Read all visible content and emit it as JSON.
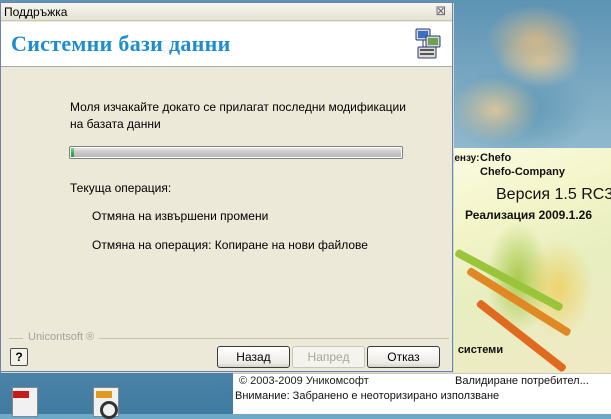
{
  "window": {
    "title": "Поддръжка",
    "close_symbol": "⊠",
    "heading": "Системни бази данни",
    "header_icon": "database-server-icon"
  },
  "content": {
    "message_line1": "Моля изчакайте докато се прилагат последни модификации",
    "message_line2": "на базата данни",
    "progress_fraction": 0.01,
    "current_operation_label": "Текуща операция:",
    "step1": "Отмяна на извършени промени",
    "step2": "Отмяна на операция: Копиране на нови файлове"
  },
  "footer": {
    "brand": "Unicontsoft ®",
    "help_label": "?",
    "back_label": "Назад",
    "next_label": "Напред",
    "cancel_label": "Отказ"
  },
  "background_window": {
    "owner_label": "дензу:",
    "owner_name": "Chefo",
    "owner_company": "Chefo-Company",
    "version": "Версия 1.5 RC3",
    "build": "Реализация 2009.1.26",
    "systems": "и системи",
    "copyright": "© 2003-2009 Уникомсофт",
    "validate": "Валидиране потребител...",
    "warning": "Внимание: Забранено е неоторизирано използване"
  },
  "desktop_icons": [
    "pdf-file-icon",
    "jpg-file-icon"
  ]
}
